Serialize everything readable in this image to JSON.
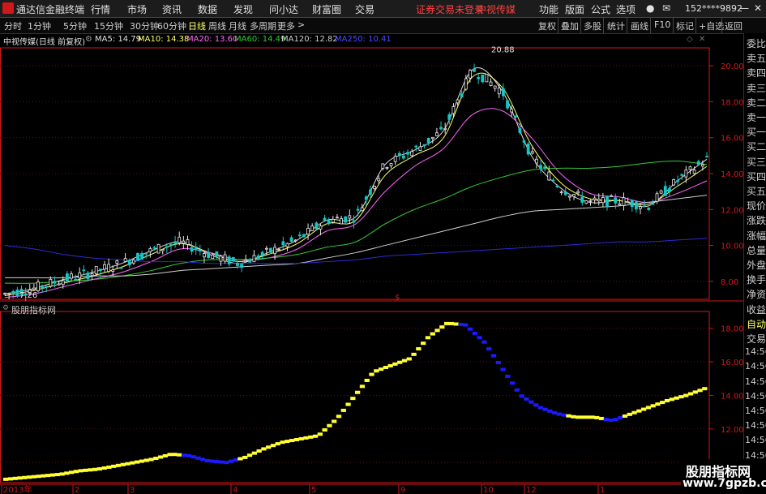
{
  "app": {
    "title": "通达信金融终端",
    "colors": {
      "up": "#e8e8e8",
      "down": "#17c6c6",
      "red": "#d0181b",
      "grid": "#6a0f0f",
      "ma5": "#e0e0e0",
      "ma10": "#ffff66",
      "ma20": "#ff66ff",
      "ma60": "#33cc33",
      "ma120": "#cfcfcf",
      "ma250": "#2b2bd6"
    }
  },
  "menu": {
    "items": [
      "行情",
      "市场",
      "资讯",
      "数据",
      "发现",
      "问小达",
      "财富圈",
      "交易"
    ],
    "status": "证券交易未登录",
    "stock": "中视传媒",
    "right": [
      "功能",
      "版面",
      "公式",
      "选项"
    ],
    "account": "152****9892"
  },
  "toolbar": {
    "periods": [
      "分时",
      "1分钟",
      "5分钟",
      "15分钟",
      "30分钟",
      "60分钟",
      "日线",
      "周线",
      "月线",
      "多周期",
      "更多"
    ],
    "active": "日线",
    "right": [
      "复权",
      "叠加",
      "多股",
      "统计",
      "画线",
      "F10",
      "标记",
      "+自选",
      "返回"
    ]
  },
  "legend": {
    "stock_label": "中视传媒(日线 前复权)",
    "ma5": "MA5: 14.79",
    "ma10": "MA10: 14.38",
    "ma20": "MA20: 13.60",
    "ma60": "MA60: 14.49",
    "ma120": "MA120: 12.82",
    "ma250": "MA250: 10.41"
  },
  "right_panel": [
    "委比",
    "卖五",
    "卖四",
    "卖三",
    "卖二",
    "卖一",
    "买一",
    "买二",
    "买三",
    "买四",
    "买五",
    "现价",
    "涨跌",
    "涨幅",
    "总量",
    "外盘",
    "换手",
    "净资",
    "收益",
    "自动",
    "交易",
    "14:56",
    "14:56",
    "14:56",
    "14:56",
    "14:56",
    "14:56",
    "14:56",
    "14:56",
    "14:56",
    "14:56"
  ],
  "panel2": {
    "title": "股朋指标网"
  },
  "annotations": {
    "high": "20.88",
    "low": "7.26",
    "marker": "$"
  },
  "watermark": {
    "title": "股朋指标网",
    "url": "www.7gpzb.com"
  },
  "chart_data": [
    {
      "type": "line",
      "title": "中视传媒(日线 前复权)",
      "y_ticks": [
        8.0,
        10.0,
        12.0,
        14.0,
        16.0,
        18.0,
        20.0
      ],
      "ylim": [
        7.0,
        21.0
      ],
      "x_ticks": [
        "2013年",
        "2",
        "3",
        "4",
        "5",
        "9",
        "10",
        "12",
        "1"
      ],
      "series": [
        {
          "name": "MA5",
          "values": [
            7.3,
            7.6,
            8.1,
            8.5,
            9.0,
            9.7,
            10.2,
            9.5,
            9.0,
            9.6,
            10.3,
            11.4,
            11.6,
            14.5,
            15.3,
            16.4,
            19.8,
            18.6,
            15.0,
            13.2,
            12.4,
            12.5,
            12.2,
            13.6,
            14.8
          ]
        },
        {
          "name": "MA10",
          "values": [
            7.2,
            7.5,
            7.9,
            8.3,
            8.8,
            9.5,
            10.1,
            9.6,
            9.1,
            9.5,
            10.1,
            11.2,
            11.4,
            13.9,
            15.0,
            16.0,
            19.4,
            18.8,
            15.6,
            13.5,
            12.6,
            12.5,
            12.3,
            13.3,
            14.4
          ]
        },
        {
          "name": "MA20",
          "values": [
            7.1,
            7.3,
            7.7,
            8.1,
            8.5,
            9.1,
            9.8,
            9.6,
            9.2,
            9.3,
            9.8,
            10.8,
            11.2,
            13.0,
            14.4,
            15.4,
            17.3,
            17.5,
            16.0,
            14.0,
            12.9,
            12.7,
            12.4,
            12.9,
            13.6
          ]
        },
        {
          "name": "MA60",
          "values": [
            7.9,
            7.9,
            8.0,
            8.1,
            8.3,
            8.6,
            9.0,
            9.2,
            9.2,
            9.3,
            9.5,
            9.9,
            10.2,
            11.2,
            12.0,
            12.6,
            13.3,
            13.8,
            14.2,
            14.3,
            14.3,
            14.4,
            14.6,
            14.7,
            14.5
          ]
        },
        {
          "name": "MA120",
          "values": [
            8.2,
            8.2,
            8.2,
            8.3,
            8.3,
            8.4,
            8.6,
            8.7,
            8.8,
            8.9,
            9.0,
            9.3,
            9.6,
            10.0,
            10.4,
            10.8,
            11.2,
            11.6,
            11.9,
            12.0,
            12.1,
            12.2,
            12.4,
            12.6,
            12.8
          ]
        },
        {
          "name": "MA250",
          "values": [
            10.0,
            9.8,
            9.5,
            9.3,
            9.2,
            9.1,
            9.1,
            9.0,
            9.0,
            9.0,
            9.0,
            9.1,
            9.2,
            9.4,
            9.5,
            9.6,
            9.7,
            9.8,
            9.9,
            10.0,
            10.1,
            10.2,
            10.2,
            10.3,
            10.4
          ]
        }
      ]
    },
    {
      "type": "line",
      "title": "股朋指标网",
      "y_ticks": [
        10.0,
        12.0,
        14.0,
        16.0,
        18.0
      ],
      "ylim": [
        8.8,
        19.0
      ],
      "series": [
        {
          "name": "",
          "values": [
            9.0,
            9.1,
            9.2,
            9.3,
            9.5,
            9.6,
            9.8,
            10.0,
            10.2,
            10.5,
            10.4,
            10.1,
            10.0,
            10.3,
            10.8,
            11.2,
            11.4,
            11.6,
            12.6,
            14.0,
            15.4,
            15.8,
            16.2,
            17.5,
            18.3,
            18.2,
            17.2,
            15.6,
            14.0,
            13.3,
            12.9,
            12.7,
            12.7,
            12.5,
            12.9,
            13.3,
            13.7,
            14.0,
            14.4
          ]
        },
        {
          "name": "",
          "values": [
            1,
            1,
            1,
            1,
            1,
            1,
            1,
            1,
            1,
            1,
            0,
            0,
            0,
            1,
            1,
            1,
            1,
            1,
            1,
            1,
            1,
            1,
            1,
            1,
            1,
            0,
            0,
            0,
            0,
            0,
            0,
            1,
            1,
            0,
            1,
            1,
            1,
            1,
            1
          ]
        }
      ]
    }
  ]
}
